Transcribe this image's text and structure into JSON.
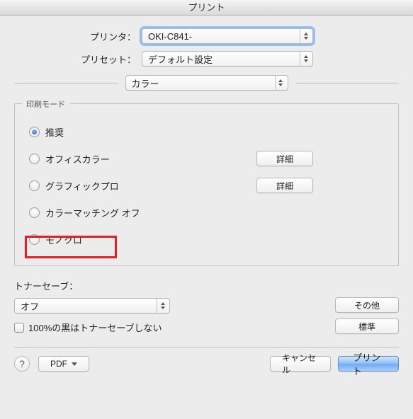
{
  "title": "プリント",
  "printer": {
    "label": "プリンタ：",
    "value": "OKI-C841-"
  },
  "preset": {
    "label": "プリセット：",
    "value": "デフォルト設定"
  },
  "pane_selector": {
    "value": "カラー"
  },
  "print_mode": {
    "legend": "印刷モード",
    "options": [
      {
        "label": "推奨",
        "checked": true,
        "detail": false
      },
      {
        "label": "オフィスカラー",
        "checked": false,
        "detail": true
      },
      {
        "label": "グラフィックプロ",
        "checked": false,
        "detail": true
      },
      {
        "label": "カラーマッチング オフ",
        "checked": false,
        "detail": false
      },
      {
        "label": "モノクロ",
        "checked": false,
        "detail": false
      }
    ],
    "detail_label": "詳細"
  },
  "tonersave": {
    "label": "トナーセーブ：",
    "value": "オフ",
    "checkbox_label": "100%の黒はトナーセーブしない",
    "checkbox_checked": false
  },
  "side_buttons": {
    "other": "その他",
    "standard": "標準"
  },
  "footer": {
    "help": "?",
    "pdf": "PDF",
    "cancel": "キャンセル",
    "print": "プリント"
  }
}
